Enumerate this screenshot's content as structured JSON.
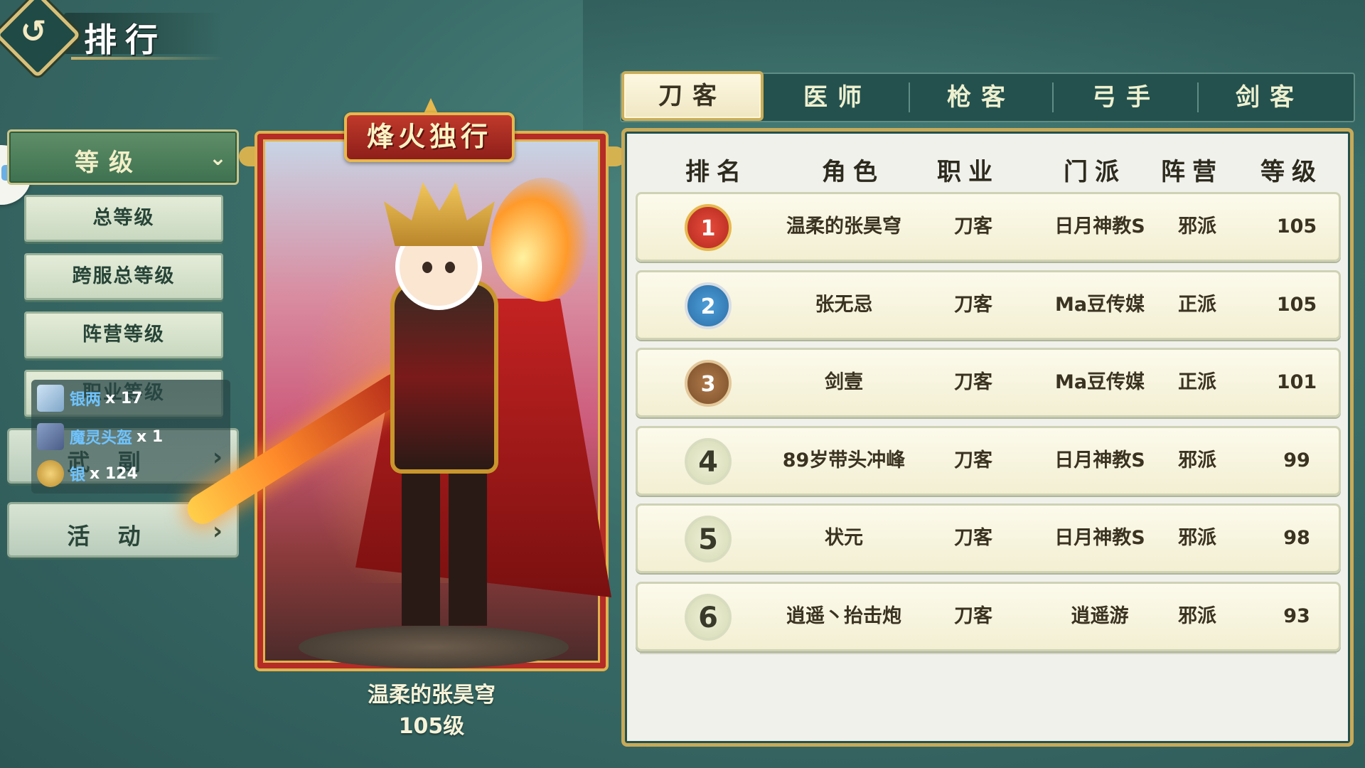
{
  "header": {
    "title": "排行"
  },
  "menu": {
    "section_label": "等级",
    "sub_items": [
      "总等级",
      "跨服总等级",
      "阵营等级",
      "职业等级"
    ],
    "categories": [
      "武 副",
      "活 动"
    ]
  },
  "reward_popup": {
    "items": [
      {
        "name": "银两",
        "count": "x 17",
        "icon": "silver-ingot-icon"
      },
      {
        "name": "魔灵头盔",
        "count": "x 1",
        "icon": "helmet-icon"
      },
      {
        "name": "银",
        "count": "x 124",
        "icon": "coin-icon"
      }
    ]
  },
  "card": {
    "banner": "烽火独行",
    "player_name": "温柔的张昊穹",
    "player_level": "105级"
  },
  "tabs": [
    {
      "label": "刀客",
      "active": true
    },
    {
      "label": "医师",
      "active": false
    },
    {
      "label": "枪客",
      "active": false
    },
    {
      "label": "弓手",
      "active": false
    },
    {
      "label": "剑客",
      "active": false
    }
  ],
  "table": {
    "headers": [
      "排名",
      "角色",
      "职业",
      "门派",
      "阵营",
      "等级"
    ],
    "rows": [
      {
        "rank": "1",
        "name": "温柔的张昊穹",
        "job": "刀客",
        "sect": "日月神教S",
        "camp": "邪派",
        "level": "105",
        "medal": "gold"
      },
      {
        "rank": "2",
        "name": "张无忌",
        "job": "刀客",
        "sect": "Ma豆传媒",
        "camp": "正派",
        "level": "105",
        "medal": "silver"
      },
      {
        "rank": "3",
        "name": "剑壹",
        "job": "刀客",
        "sect": "Ma豆传媒",
        "camp": "正派",
        "level": "101",
        "medal": "bronze"
      },
      {
        "rank": "4",
        "name": "89岁带头冲峰",
        "job": "刀客",
        "sect": "日月神教S",
        "camp": "邪派",
        "level": "99",
        "medal": "plain"
      },
      {
        "rank": "5",
        "name": "状元",
        "job": "刀客",
        "sect": "日月神教S",
        "camp": "邪派",
        "level": "98",
        "medal": "plain"
      },
      {
        "rank": "6",
        "name": "逍遥丶抬击炮",
        "job": "刀客",
        "sect": "逍遥游",
        "camp": "邪派",
        "level": "93",
        "medal": "plain"
      }
    ]
  },
  "colors": {
    "background": "#3a6d69",
    "accent_gold": "#c7aa58",
    "card_red": "#b52b26",
    "tab_bar": "#24514d"
  }
}
